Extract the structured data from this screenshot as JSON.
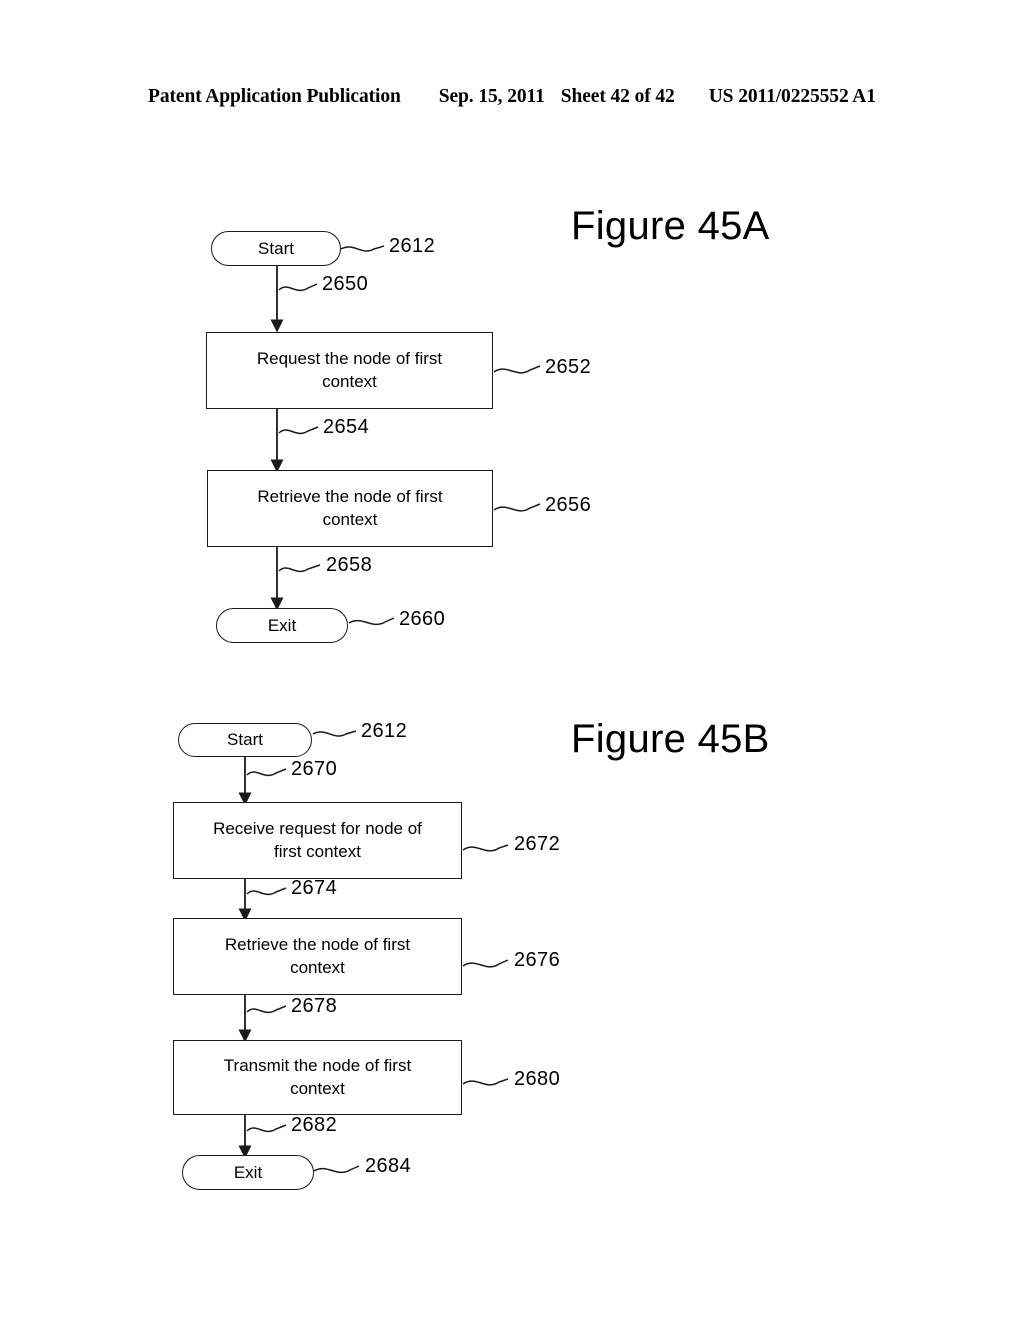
{
  "header": {
    "publication": "Patent Application Publication",
    "date": "Sep. 15, 2011",
    "sheet": "Sheet 42 of 42",
    "patent_number": "US 2011/0225552 A1"
  },
  "figures": [
    {
      "id": "45a",
      "title": "Figure 45A",
      "nodes": [
        {
          "key": "start",
          "type": "terminator",
          "label": "Start",
          "ref": "2612"
        },
        {
          "key": "request",
          "type": "process",
          "line1": "Request the node of first",
          "line2": "context",
          "ref": "2652"
        },
        {
          "key": "retrieve",
          "type": "process",
          "line1": "Retrieve the node of first",
          "line2": "context",
          "ref": "2656"
        },
        {
          "key": "exit",
          "type": "terminator",
          "label": "Exit",
          "ref": "2660"
        }
      ],
      "edges": [
        {
          "key": "e1",
          "from": "start",
          "to": "request",
          "ref": "2650"
        },
        {
          "key": "e2",
          "from": "request",
          "to": "retrieve",
          "ref": "2654"
        },
        {
          "key": "e3",
          "from": "retrieve",
          "to": "exit",
          "ref": "2658"
        }
      ]
    },
    {
      "id": "45b",
      "title": "Figure 45B",
      "nodes": [
        {
          "key": "start",
          "type": "terminator",
          "label": "Start",
          "ref": "2612"
        },
        {
          "key": "receive",
          "type": "process",
          "line1": "Receive request for node of",
          "line2": "first context",
          "ref": "2672"
        },
        {
          "key": "retrieve",
          "type": "process",
          "line1": "Retrieve the node of first",
          "line2": "context",
          "ref": "2676"
        },
        {
          "key": "transmit",
          "type": "process",
          "line1": "Transmit the node of first",
          "line2": "context",
          "ref": "2680"
        },
        {
          "key": "exit",
          "type": "terminator",
          "label": "Exit",
          "ref": "2684"
        }
      ],
      "edges": [
        {
          "key": "e1",
          "from": "start",
          "to": "receive",
          "ref": "2670"
        },
        {
          "key": "e2",
          "from": "receive",
          "to": "retrieve",
          "ref": "2674"
        },
        {
          "key": "e3",
          "from": "retrieve",
          "to": "transmit",
          "ref": "2678"
        },
        {
          "key": "e4",
          "from": "transmit",
          "to": "exit",
          "ref": "2682"
        }
      ]
    }
  ]
}
